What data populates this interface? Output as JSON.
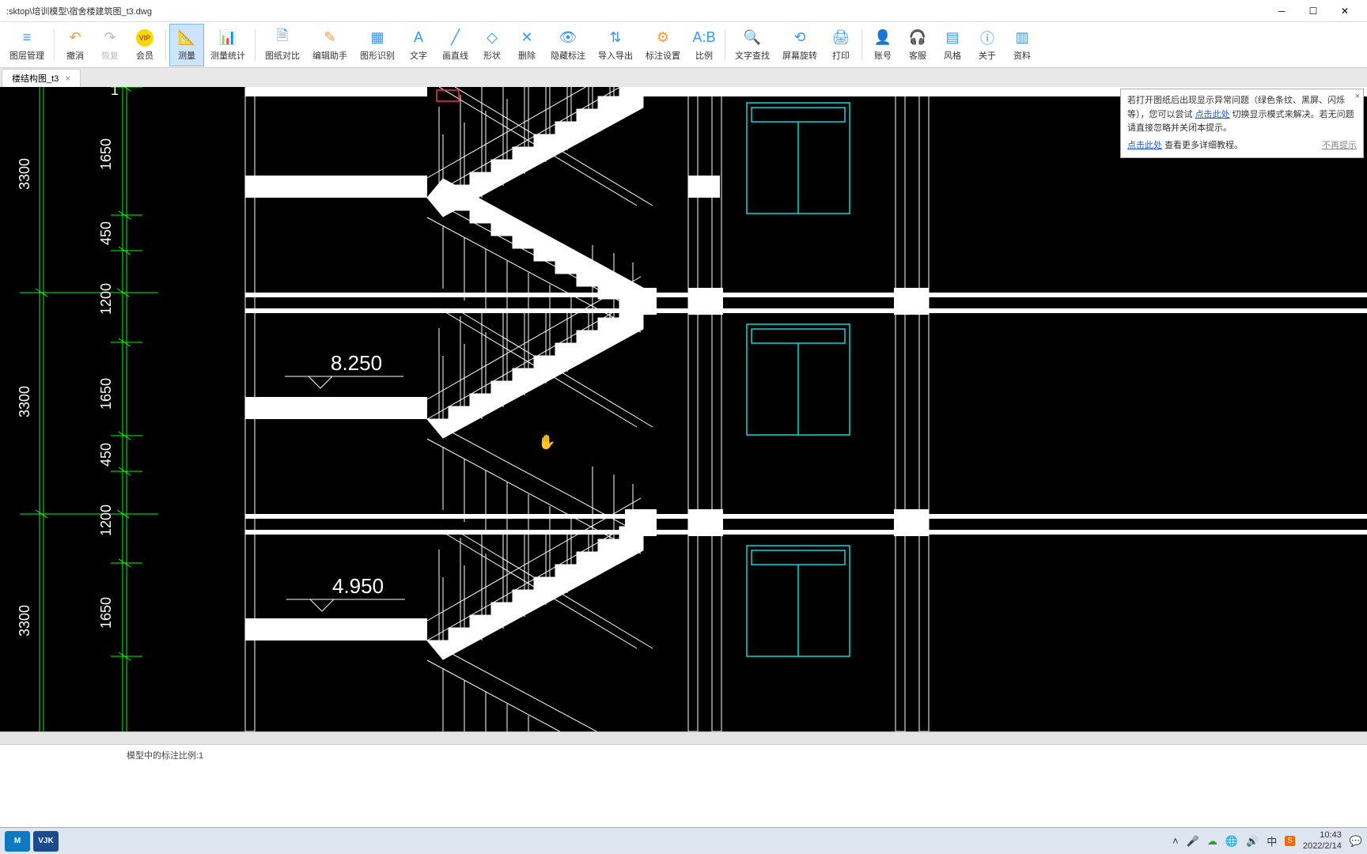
{
  "window": {
    "title": ":sktop\\培训模型\\宿舍楼建筑图_t3.dwg"
  },
  "toolbar": [
    {
      "id": "layers",
      "label": "图层管理",
      "icon": "≡",
      "color": "#3399ff"
    },
    {
      "id": "undo",
      "label": "撤消",
      "icon": "↶",
      "color": "#ff9933"
    },
    {
      "id": "redo",
      "label": "恢复",
      "icon": "↷",
      "color": "#bbb"
    },
    {
      "id": "vip",
      "label": "会员",
      "icon": "VIP",
      "color": "#ffd700"
    },
    {
      "id": "measure",
      "label": "测量",
      "icon": "📐",
      "color": "#ff9933",
      "active": true
    },
    {
      "id": "measure-stats",
      "label": "测量统计",
      "icon": "📊",
      "color": "#3399ff"
    },
    {
      "id": "compare",
      "label": "图纸对比",
      "icon": "🗎",
      "color": "#3399ff"
    },
    {
      "id": "edit-helper",
      "label": "编辑助手",
      "icon": "✎",
      "color": "#ff9933"
    },
    {
      "id": "shape-recog",
      "label": "图形识别",
      "icon": "▦",
      "color": "#3399ff"
    },
    {
      "id": "text",
      "label": "文字",
      "icon": "A",
      "color": "#3399ff"
    },
    {
      "id": "line",
      "label": "画直线",
      "icon": "╱",
      "color": "#3399ff"
    },
    {
      "id": "shape",
      "label": "形状",
      "icon": "◇",
      "color": "#3399ff"
    },
    {
      "id": "delete",
      "label": "删除",
      "icon": "✕",
      "color": "#3399ff"
    },
    {
      "id": "hide-ann",
      "label": "隐藏标注",
      "icon": "👁",
      "color": "#3399ff"
    },
    {
      "id": "import-export",
      "label": "导入导出",
      "icon": "⇅",
      "color": "#3399ff"
    },
    {
      "id": "ann-settings",
      "label": "标注设置",
      "icon": "⚙",
      "color": "#ff9933"
    },
    {
      "id": "scale",
      "label": "比例",
      "icon": "A:B",
      "color": "#3399ff"
    },
    {
      "id": "find-text",
      "label": "文字查找",
      "icon": "🔍",
      "color": "#3399ff"
    },
    {
      "id": "rotate-screen",
      "label": "屏幕旋转",
      "icon": "⟲",
      "color": "#3399ff"
    },
    {
      "id": "print",
      "label": "打印",
      "icon": "🖨",
      "color": "#3399ff"
    },
    {
      "id": "account",
      "label": "账号",
      "icon": "👤",
      "color": "#3399ff"
    },
    {
      "id": "support",
      "label": "客服",
      "icon": "🎧",
      "color": "#3399ff"
    },
    {
      "id": "style",
      "label": "风格",
      "icon": "▤",
      "color": "#3399ff"
    },
    {
      "id": "about",
      "label": "关于",
      "icon": "ⓘ",
      "color": "#3399ff"
    },
    {
      "id": "resources",
      "label": "资料",
      "icon": "▥",
      "color": "#3399ff"
    }
  ],
  "tab": {
    "label": "楼结构图_t3",
    "close": "×"
  },
  "hint": {
    "text_before": "若打开图纸后出现显示异常问题（绿色条纹、黑屏、闪烁等），您可以尝试",
    "link1": "点击此处",
    "text_after": "切换显示模式来解决。若无问题请直接忽略并关闭本提示。",
    "link2": "点击此处",
    "more": "查看更多详细教程。",
    "no_remind": "不再提示"
  },
  "drawing": {
    "dims_v_large": [
      "3300",
      "3300",
      "3300"
    ],
    "dims_v_small": [
      "1650",
      "450",
      "1200",
      "1650",
      "450",
      "1200",
      "1650"
    ],
    "elevations": [
      "8.250",
      "4.950"
    ],
    "top_dim_start": "1"
  },
  "status": {
    "text": "模型中的标注比例:1"
  },
  "tray": {
    "time": "10:43",
    "date": "2022/2/14"
  }
}
